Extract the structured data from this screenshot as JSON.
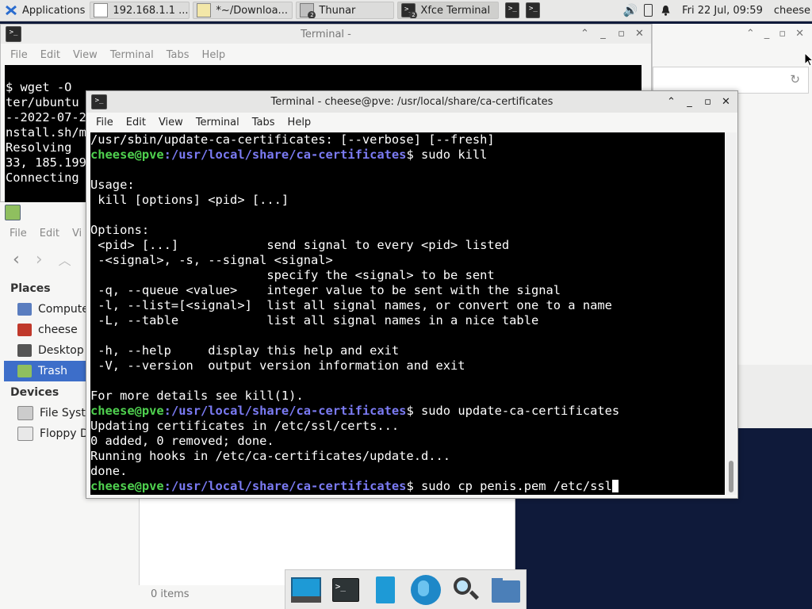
{
  "top_panel": {
    "applications_label": "Applications",
    "tasks": [
      {
        "label": "192.168.1.1 ...",
        "icon": "document-icon",
        "badge": ""
      },
      {
        "label": "*~/Downloa...",
        "icon": "text-editor-icon",
        "badge": ""
      },
      {
        "label": "Thunar",
        "icon": "thunar-icon",
        "badge": "2"
      },
      {
        "label": "Xfce Terminal",
        "icon": "terminal-icon",
        "badge": "2"
      }
    ],
    "clock": "Fri 22 Jul, 09:59",
    "user": "cheese"
  },
  "back_terminal": {
    "title": "Terminal -",
    "menu": [
      "File",
      "Edit",
      "View",
      "Terminal",
      "Tabs",
      "Help"
    ],
    "lines": [
      "",
      "$ wget -O",
      "ter/ubuntu",
      "--2022-07-2",
      "nstall.sh/m",
      "Resolving",
      "33, 185.199",
      "Connecting"
    ]
  },
  "thunar": {
    "menu": [
      "File",
      "Edit",
      "Vi"
    ],
    "places_header": "Places",
    "places": [
      "Compute",
      "cheese",
      "Desktop",
      "Trash"
    ],
    "devices_header": "Devices",
    "devices": [
      "File Syste",
      "Floppy D"
    ],
    "status": "0 items"
  },
  "front_terminal": {
    "title": "Terminal - cheese@pve: /usr/local/share/ca-certificates",
    "menu": [
      "File",
      "Edit",
      "View",
      "Terminal",
      "Tabs",
      "Help"
    ],
    "prompt_user": "cheese@pve",
    "prompt_path": ":/usr/local/share/ca-certificates",
    "lines": [
      {
        "text": "/usr/sbin/update-ca-certificates: [--verbose] [--fresh]"
      },
      {
        "prompt": true,
        "cmd": "$ sudo kill"
      },
      {
        "text": ""
      },
      {
        "text": "Usage:"
      },
      {
        "text": " kill [options] <pid> [...]"
      },
      {
        "text": ""
      },
      {
        "text": "Options:"
      },
      {
        "text": " <pid> [...]            send signal to every <pid> listed"
      },
      {
        "text": " -<signal>, -s, --signal <signal>"
      },
      {
        "text": "                        specify the <signal> to be sent"
      },
      {
        "text": " -q, --queue <value>    integer value to be sent with the signal"
      },
      {
        "text": " -l, --list=[<signal>]  list all signal names, or convert one to a name"
      },
      {
        "text": " -L, --table            list all signal names in a nice table"
      },
      {
        "text": ""
      },
      {
        "text": " -h, --help     display this help and exit"
      },
      {
        "text": " -V, --version  output version information and exit"
      },
      {
        "text": ""
      },
      {
        "text": "For more details see kill(1)."
      },
      {
        "prompt": true,
        "cmd": "$ sudo update-ca-certificates"
      },
      {
        "text": "Updating certificates in /etc/ssl/certs..."
      },
      {
        "text": "0 added, 0 removed; done."
      },
      {
        "text": "Running hooks in /etc/ca-certificates/update.d..."
      },
      {
        "text": "done."
      },
      {
        "prompt": true,
        "cmd": "$ sudo cp penis.pem /etc/ssl",
        "cursor": true
      }
    ]
  },
  "dock": [
    "show-desktop-icon",
    "terminal-icon",
    "file-manager-icon",
    "web-browser-icon",
    "app-finder-icon",
    "folder-icon"
  ],
  "colors": {
    "prompt_user": "#4fd14f",
    "prompt_path": "#7b7bf4",
    "selection": "#3d6ec9",
    "desktop": "#0f1a3a"
  }
}
